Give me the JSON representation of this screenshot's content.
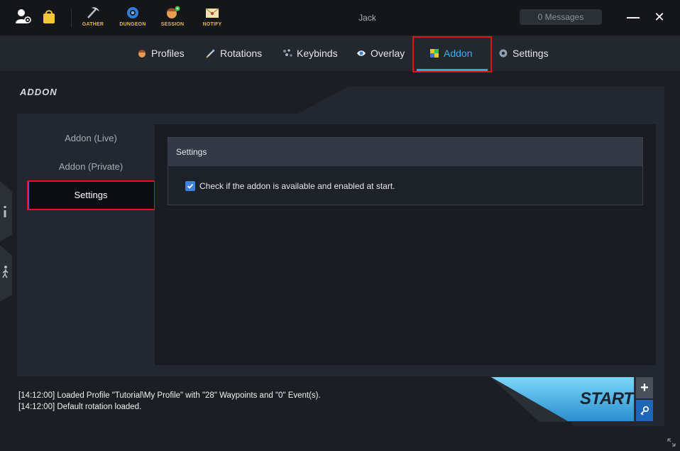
{
  "topbar": {
    "tools": [
      {
        "label": "GATHER",
        "icon": "pickaxe-icon"
      },
      {
        "label": "DUNGEON",
        "icon": "dungeon-gear-icon"
      },
      {
        "label": "SESSION",
        "icon": "session-avatar-icon"
      },
      {
        "label": "NOTIFY",
        "icon": "envelope-icon"
      }
    ],
    "username": "Jack",
    "messages": "0 Messages",
    "minimize": "—",
    "close": "✕"
  },
  "nav": {
    "tabs": [
      {
        "label": "Profiles",
        "icon": "profile-avatar-icon"
      },
      {
        "label": "Rotations",
        "icon": "sword-icon"
      },
      {
        "label": "Keybinds",
        "icon": "keybind-dots-icon"
      },
      {
        "label": "Overlay",
        "icon": "eye-icon"
      },
      {
        "label": "Addon",
        "icon": "addon-puzzle-icon"
      },
      {
        "label": "Settings",
        "icon": "gear-icon"
      }
    ],
    "active": "Addon"
  },
  "page": {
    "heading": "ADDON",
    "menu": [
      {
        "label": "Addon (Live)"
      },
      {
        "label": "Addon (Private)"
      },
      {
        "label": "Settings"
      }
    ],
    "settings_header": "Settings",
    "checkbox": {
      "label": "Check if the addon is available and enabled at start.",
      "checked": true
    }
  },
  "log": {
    "lines": [
      "[14:12:00] Loaded Profile \"Tutorial\\My Profile\" with \"28\" Waypoints and \"0\" Event(s).",
      "[14:12:00] Default rotation loaded."
    ]
  },
  "start": {
    "label": "START",
    "add": "+",
    "key_icon": "key-icon"
  },
  "colors": {
    "accent": "#2aa8e8",
    "start_gradient_top": "#6fd0f5",
    "start_gradient_bottom": "#2a8fd0",
    "highlight": "#e01616",
    "tool_label": "#e7b93b"
  }
}
